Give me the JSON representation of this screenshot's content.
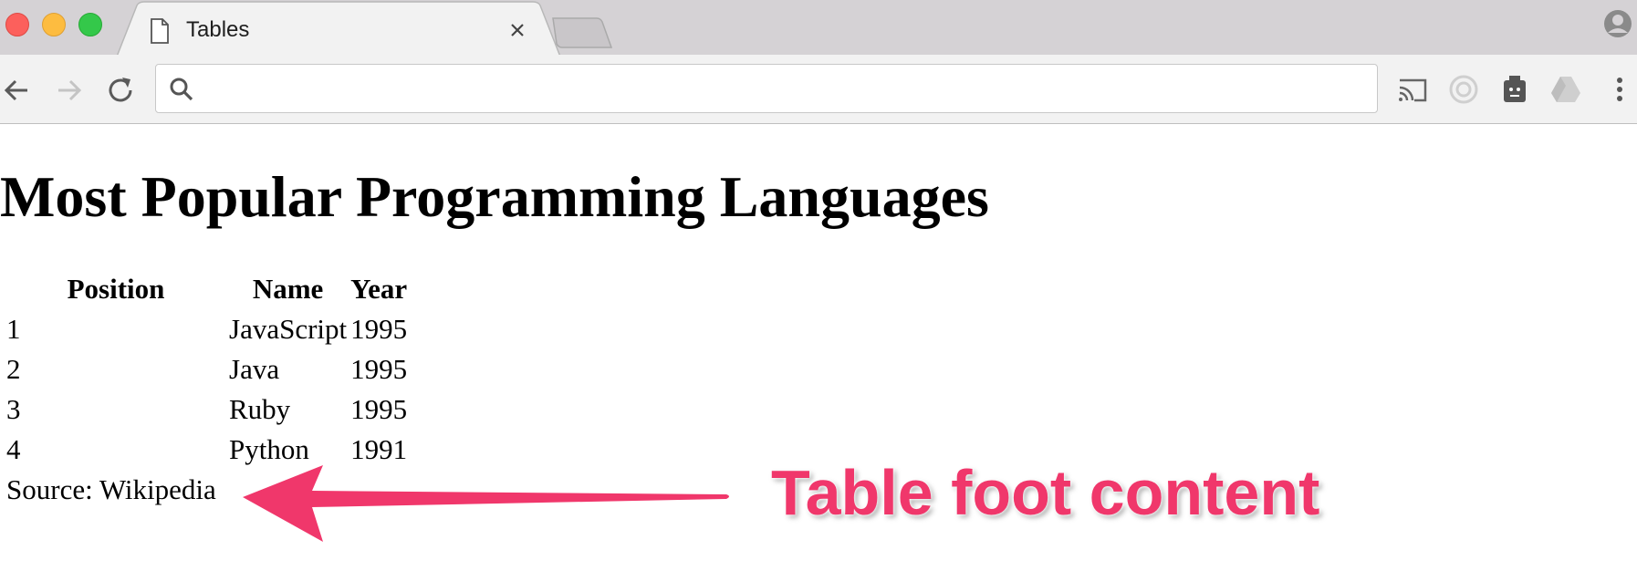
{
  "browser": {
    "tab": {
      "title": "Tables",
      "close_icon": "close-icon",
      "page_icon": "document-icon"
    },
    "toolbar": {
      "search_icon": "search-icon",
      "address_value": "",
      "extensions": [
        "cast-icon",
        "extension-icon",
        "extension-icon",
        "drive-icon",
        "menu-icon"
      ]
    },
    "colors": {
      "close": "#fc605c",
      "minimize": "#fdbc40",
      "maximize": "#34c84a",
      "chrome_bg": "#d5d2d5"
    }
  },
  "page": {
    "title": "Most Popular Programming Languages",
    "table": {
      "headers": [
        "Position",
        "Name",
        "Year"
      ],
      "rows": [
        [
          "1",
          "JavaScript",
          "1995"
        ],
        [
          "2",
          "Java",
          "1995"
        ],
        [
          "3",
          "Ruby",
          "1995"
        ],
        [
          "4",
          "Python",
          "1991"
        ]
      ],
      "footer": "Source: Wikipedia"
    }
  },
  "annotation": {
    "text": "Table foot content",
    "color": "#f0376b"
  }
}
